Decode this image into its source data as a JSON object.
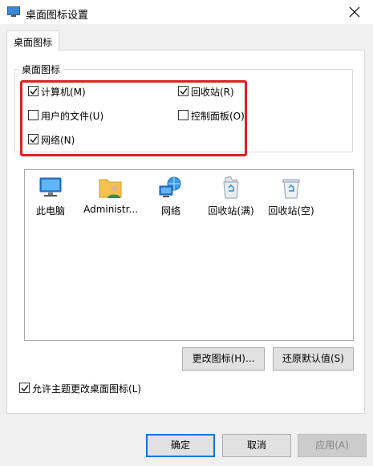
{
  "window": {
    "title": "桌面图标设置",
    "close_icon": "close-icon"
  },
  "tabs": [
    {
      "label": "桌面图标"
    }
  ],
  "group": {
    "title": "桌面图标"
  },
  "checkboxes": [
    {
      "label": "计算机(M)",
      "checked": true
    },
    {
      "label": "回收站(R)",
      "checked": true
    },
    {
      "label": "用户的文件(U)",
      "checked": false
    },
    {
      "label": "控制面板(O)",
      "checked": false
    },
    {
      "label": "网络(N)",
      "checked": true
    }
  ],
  "highlight_color": "#e02020",
  "desktop_icons": [
    {
      "label": "此电脑",
      "icon": "computer-icon"
    },
    {
      "label": "Administr...",
      "icon": "user-folder-icon"
    },
    {
      "label": "网络",
      "icon": "network-icon"
    },
    {
      "label": "回收站(满)",
      "icon": "recycle-bin-full-icon"
    },
    {
      "label": "回收站(空)",
      "icon": "recycle-bin-empty-icon"
    }
  ],
  "buttons": {
    "change_icon": "更改图标(H)...",
    "restore_default": "还原默认值(S)",
    "ok": "确定",
    "cancel": "取消",
    "apply": "应用(A)"
  },
  "allow_themes": {
    "label": "允许主题更改桌面图标(L)",
    "checked": true
  }
}
